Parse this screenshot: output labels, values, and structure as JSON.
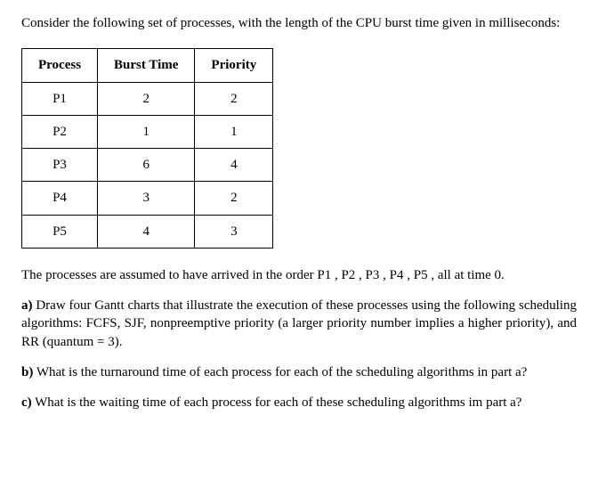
{
  "intro": "Consider the following set of processes, with the length of the CPU burst time given in milliseconds:",
  "table": {
    "headers": [
      "Process",
      "Burst Time",
      "Priority"
    ],
    "rows": [
      [
        "P1",
        "2",
        "2"
      ],
      [
        "P2",
        "1",
        "1"
      ],
      [
        "P3",
        "6",
        "4"
      ],
      [
        "P4",
        "3",
        "2"
      ],
      [
        "P5",
        "4",
        "3"
      ]
    ]
  },
  "assumption": "The processes are assumed to have arrived in the order P1 , P2 , P3 , P4 , P5 , all at time 0.",
  "questions": {
    "a": {
      "label": "a)",
      "text": " Draw four Gantt charts that illustrate the execution of these processes using the following scheduling algorithms: FCFS, SJF, nonpreemptive priority (a larger priority number implies a higher priority), and RR (quantum = 3)."
    },
    "b": {
      "label": "b)",
      "text": " What is the turnaround time of each process for each of the scheduling algorithms in part a?"
    },
    "c": {
      "label": "c)",
      "text": " What is the waiting time of each process for each of these scheduling algorithms im part a?"
    }
  }
}
